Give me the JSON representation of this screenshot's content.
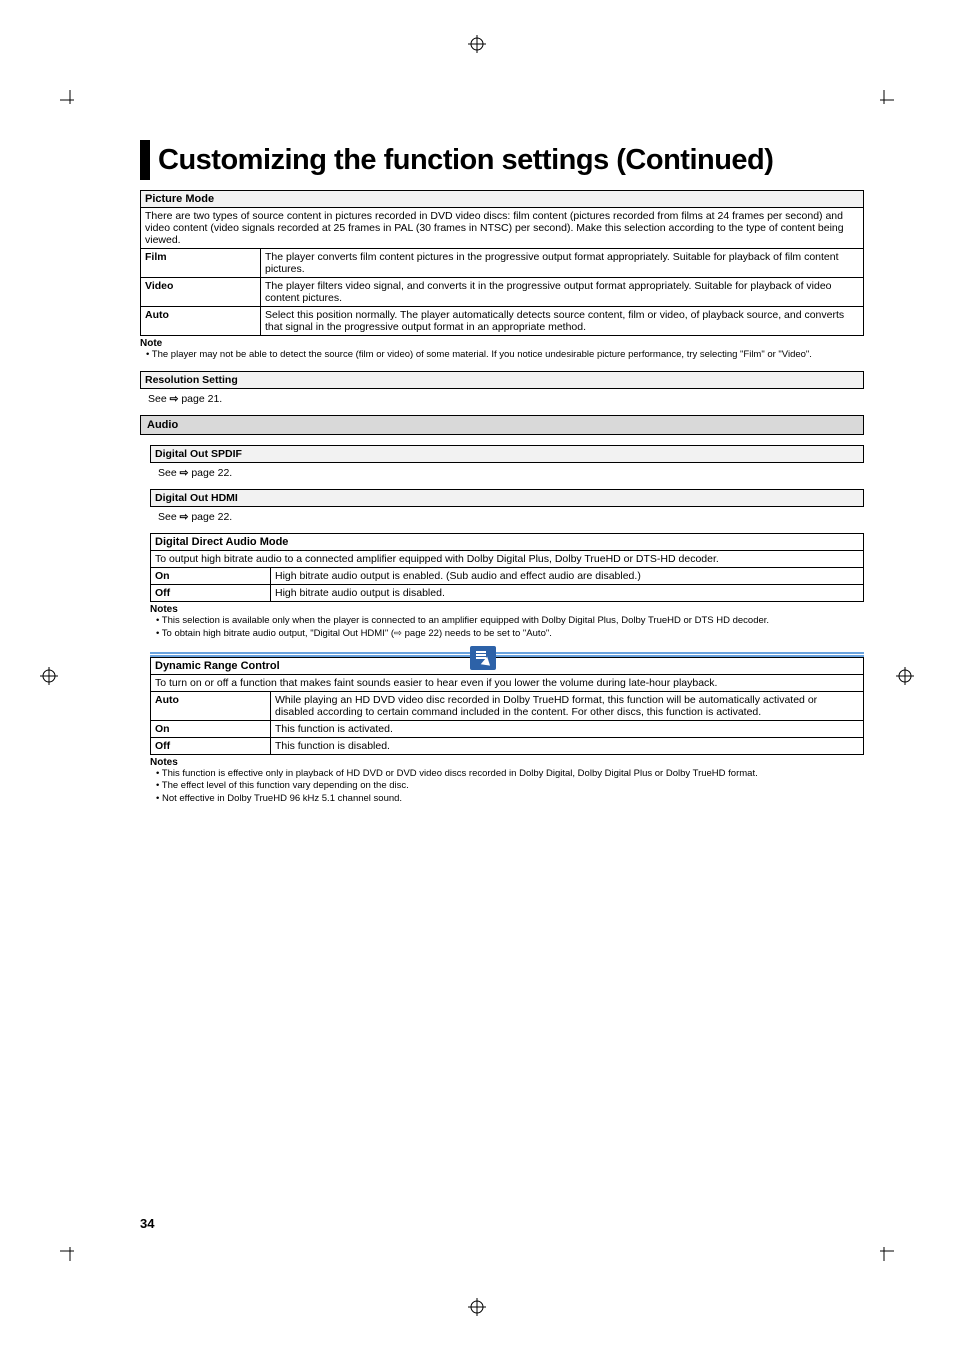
{
  "title": "Customizing the function settings (Continued)",
  "picture_mode": {
    "header": "Picture Mode",
    "description": "There are two types of source content in pictures recorded in DVD video discs: film content (pictures recorded from films at 24 frames per second) and video content (video signals recorded at 25 frames in PAL (30 frames in NTSC) per second). Make this selection according to the type of content being viewed.",
    "options": [
      {
        "label": "Film",
        "text": "The player converts film content pictures in the progressive output format appropriately. Suitable for playback of film content pictures."
      },
      {
        "label": "Video",
        "text": "The player filters video signal, and converts it in the progressive output format appropriately. Suitable for playback of video content pictures."
      },
      {
        "label": "Auto",
        "text": "Select this position normally. The player automatically detects source content, film or video, of playback source, and converts that signal in the progressive output format in an appropriate method."
      }
    ],
    "note_heading": "Note",
    "notes": [
      "The player may not be able to detect the source (film or video) of some material. If you notice undesirable picture performance, try selecting \"Film\" or \"Video\"."
    ]
  },
  "resolution": {
    "header": "Resolution Setting",
    "see": "See �INSERT_ARROW page 21."
  },
  "audio_category": "Audio",
  "dout_spdif": {
    "header": "Digital Out SPDIF",
    "see": "See �INSERT_ARROW page 22."
  },
  "dout_hdmi": {
    "header": "Digital Out HDMI",
    "see": "See �INSERT_ARROW page 22."
  },
  "ddam": {
    "header": "Digital Direct Audio Mode",
    "description": "To output high bitrate audio to a connected amplifier equipped with Dolby Digital Plus, Dolby TrueHD or DTS-HD decoder.",
    "options": [
      {
        "label": "On",
        "text": "High bitrate audio output is enabled. (Sub audio and effect audio are disabled.)"
      },
      {
        "label": "Off",
        "text": "High bitrate audio output is disabled."
      }
    ],
    "note_heading": "Notes",
    "notes": [
      "This selection is available only when the player is connected to an amplifier equipped with Dolby Digital Plus, Dolby TrueHD or DTS HD decoder.",
      "To obtain high bitrate audio output, \"Digital Out HDMI\" (⇨ page 22) needs to be set to \"Auto\"."
    ]
  },
  "drc": {
    "header": "Dynamic Range Control",
    "description": "To turn on or off a function that makes faint sounds easier to hear even if you lower the volume during late-hour playback.",
    "options": [
      {
        "label": "Auto",
        "text": "While playing an HD DVD video disc recorded in Dolby TrueHD format, this function will be automatically activated or disabled according to certain command included in the content. For other discs, this function is activated."
      },
      {
        "label": "On",
        "text": "This function is activated."
      },
      {
        "label": "Off",
        "text": "This function is disabled."
      }
    ],
    "note_heading": "Notes",
    "notes": [
      "This function is effective only in playback of HD DVD or DVD video discs recorded in Dolby Digital, Dolby Digital Plus or Dolby TrueHD format.",
      "The effect level of this function vary depending on the disc.",
      "Not effective in Dolby TrueHD 96 kHz 5.1 channel sound."
    ]
  },
  "page_number": "34"
}
